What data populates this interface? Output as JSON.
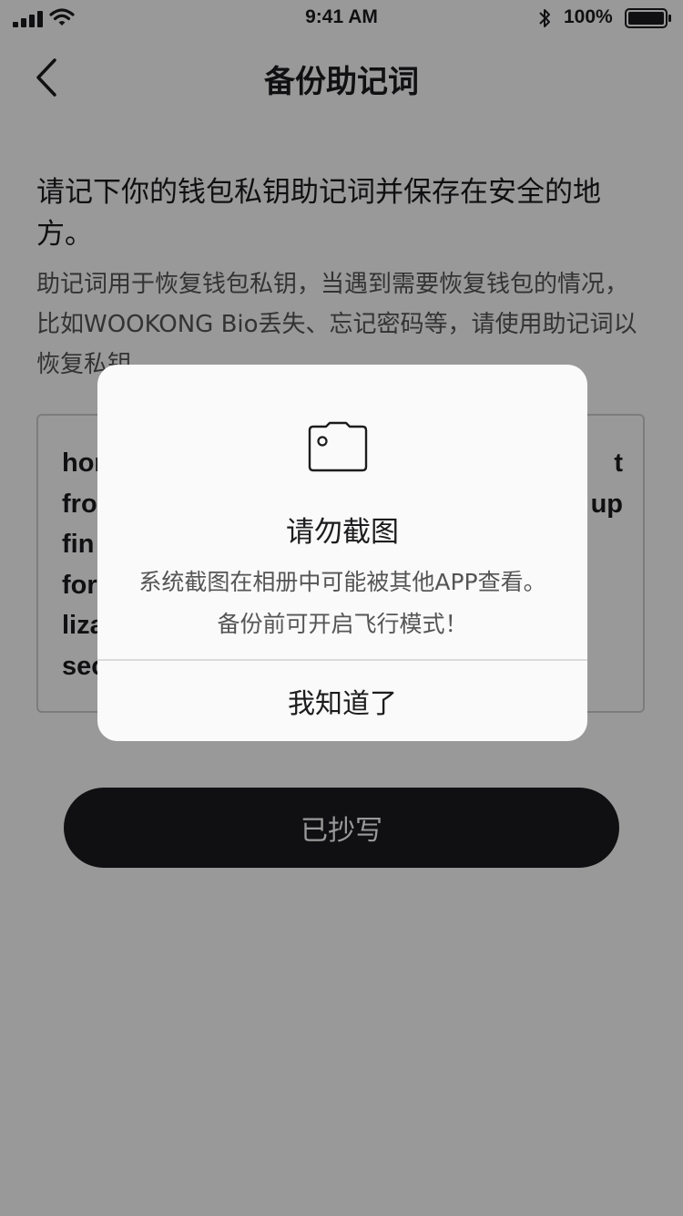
{
  "status_bar": {
    "time": "9:41 AM",
    "battery_percent": "100%",
    "battery_level": 1.0
  },
  "nav": {
    "title": "备份助记词",
    "back_icon": "chevron-left-icon"
  },
  "content": {
    "intro": "请记下你的钱包私钥助记词并保存在安全的地方。",
    "description": "助记词用于恢复钱包私钥，当遇到需要恢复钱包的情况，比如WOOKONG Bio丢失、忘记密码等，请使用助记词以恢复私钥。",
    "words": [
      "hor",
      "",
      "",
      "t",
      "fro",
      "",
      "",
      "up",
      "fin",
      "",
      "",
      "",
      "for",
      "",
      "",
      "",
      "liza",
      "",
      "",
      "",
      "sec",
      "",
      "",
      ""
    ]
  },
  "primary_button": {
    "label": "已抄写"
  },
  "dialog": {
    "icon": "camera-icon",
    "title": "请勿截图",
    "message": "系统截图在相册中可能被其他APP查看。备份前可开启飞行模式！",
    "button_label": "我知道了"
  },
  "colors": {
    "overlay": "rgba(0,0,0,0.4)",
    "primary_button_bg": "#1c1c1e",
    "dialog_bg": "#fafafa"
  }
}
